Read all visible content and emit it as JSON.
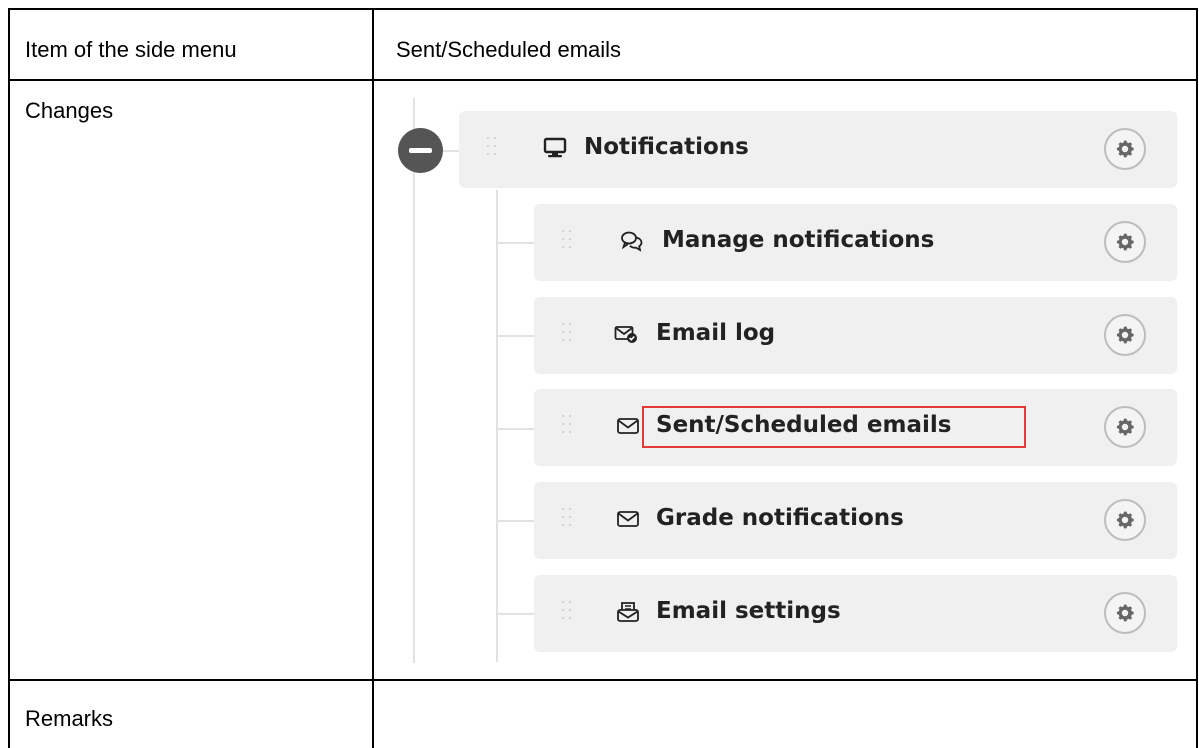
{
  "table": {
    "row1": {
      "label": "Item of the side menu",
      "value": "Sent/Scheduled emails"
    },
    "row2": {
      "label": "Changes"
    },
    "row3": {
      "label": "Remarks",
      "value": ""
    }
  },
  "menu": {
    "parent": {
      "label": "Notifications",
      "icon": "monitor-icon"
    },
    "children": [
      {
        "label": "Manage notifications",
        "icon": "chat-bubbles-icon"
      },
      {
        "label": "Email log",
        "icon": "envelope-check-icon"
      },
      {
        "label": "Sent/Scheduled emails",
        "icon": "envelope-icon",
        "highlighted": true
      },
      {
        "label": "Grade notifications",
        "icon": "envelope-icon"
      },
      {
        "label": "Email settings",
        "icon": "envelope-list-icon"
      }
    ]
  },
  "colors": {
    "highlight": "#e53935",
    "item_bg": "#f0f0f0",
    "collapse": "#555555"
  }
}
